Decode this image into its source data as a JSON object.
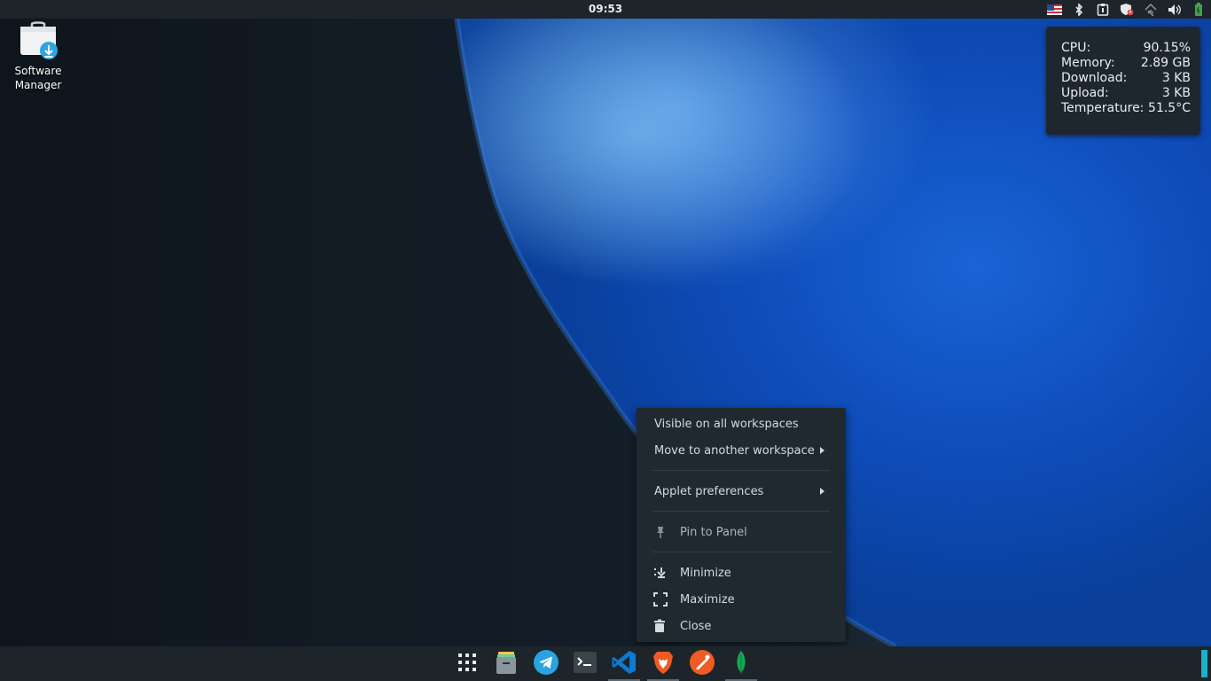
{
  "top_panel": {
    "clock": "09:53",
    "tray_icons": [
      "us-flag-icon",
      "bluetooth-icon",
      "clipboard-icon",
      "shield-update-icon",
      "network-icon",
      "volume-icon",
      "battery-icon"
    ]
  },
  "desktop": {
    "icons": [
      {
        "label": "Software\nManager",
        "icon": "software-manager-icon"
      }
    ]
  },
  "sysmon": {
    "rows": [
      {
        "label": "CPU:",
        "value": "90.15%"
      },
      {
        "label": "Memory:",
        "value": "2.89 GB"
      },
      {
        "label": "Download:",
        "value": "3 KB"
      },
      {
        "label": "Upload:",
        "value": "3 KB"
      },
      {
        "label": "Temperature:",
        "value": "51.5°C"
      }
    ]
  },
  "context_menu": {
    "visible_all": "Visible on all workspaces",
    "move_workspace": "Move to another workspace",
    "applet_prefs": "Applet preferences",
    "pin_panel": "Pin to Panel",
    "minimize": "Minimize",
    "maximize": "Maximize",
    "close": "Close"
  },
  "taskbar": {
    "items": [
      "app-grid-icon",
      "files-icon",
      "telegram-icon",
      "terminal-icon",
      "vscode-icon",
      "brave-icon",
      "postman-icon",
      "mongodb-compass-icon"
    ]
  },
  "colors": {
    "panel_bg": "#1d252b",
    "menu_bg": "#20292f",
    "accent": "#19b2c7",
    "wallpaper_blue": "#1a63d6"
  }
}
